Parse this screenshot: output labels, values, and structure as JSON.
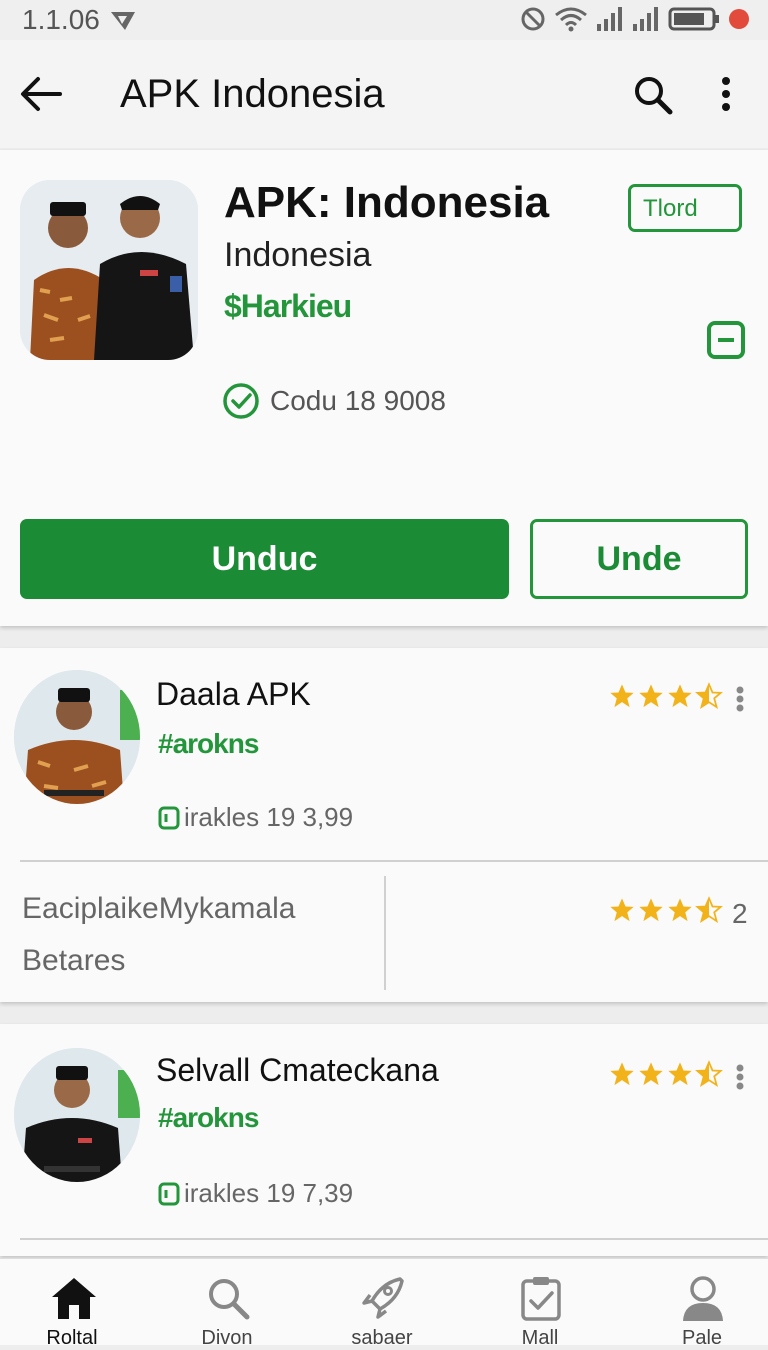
{
  "status_bar": {
    "time": "1.1.06"
  },
  "app_bar": {
    "title": "APK Indonesia"
  },
  "hero": {
    "name": "APK: Indonesia",
    "subtitle": "Indonesia",
    "tag": "$Harkieu",
    "badge": "Tlord",
    "verified": "Codu 18 9008",
    "primary_button": "Unduc",
    "secondary_button": "Unde"
  },
  "list": [
    {
      "title": "Daala APK",
      "tag": "#arokns",
      "meta": "irakles 19 3,99",
      "rating": 3.5
    },
    {
      "title": "Selvall Cmateckana",
      "tag": "#arokns",
      "meta": "irakles 19 7,39",
      "rating": 3.5
    }
  ],
  "sub_row": {
    "line1": "EaciplaikeMykamala",
    "line2": "Betares",
    "rating": 3.5,
    "count": "2"
  },
  "bottom_nav": [
    {
      "label": "Roltal",
      "icon": "home-icon"
    },
    {
      "label": "Divon",
      "icon": "search-icon"
    },
    {
      "label": "sabaer",
      "icon": "rocket-icon"
    },
    {
      "label": "Mall",
      "icon": "clipboard-check-icon"
    },
    {
      "label": "Pale",
      "icon": "person-icon"
    }
  ],
  "colors": {
    "accent": "#1c8b35",
    "star": "#f2b21a"
  }
}
